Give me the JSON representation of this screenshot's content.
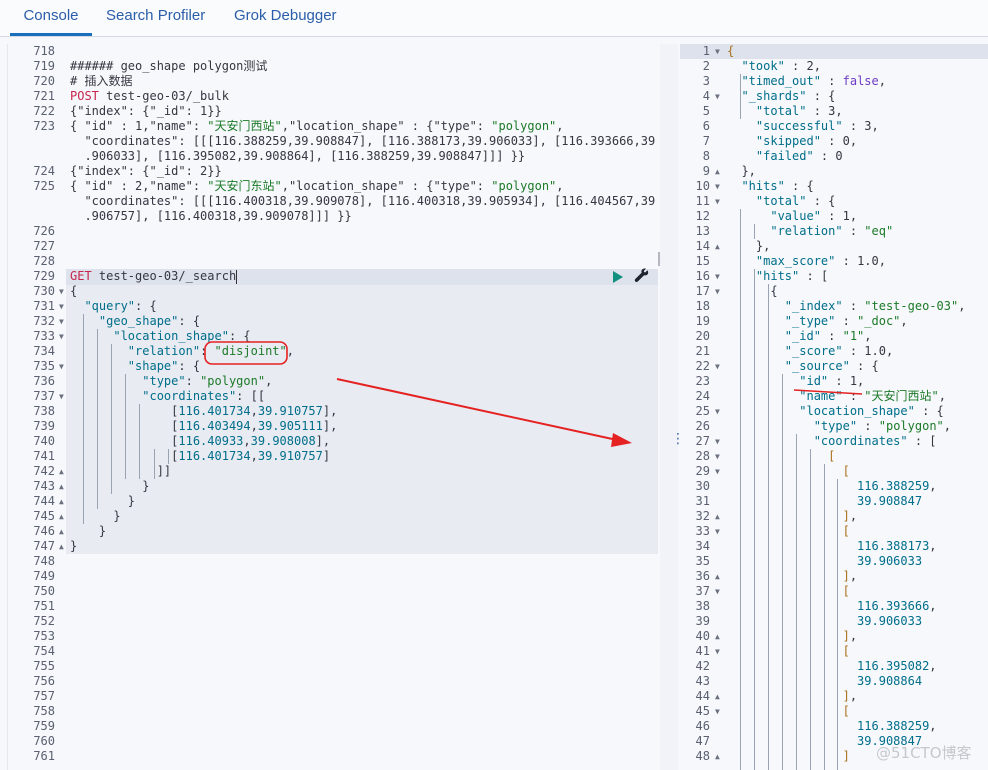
{
  "tabs": [
    {
      "label": "Console",
      "active": true
    },
    {
      "label": "Search Profiler",
      "active": false
    },
    {
      "label": "Grok Debugger",
      "active": false
    }
  ],
  "colors": {
    "accent": "#1a6fbd",
    "method": "#c7254e",
    "string": "#1c7a28",
    "key": "#006e8a",
    "keyword": "#6d3bc4",
    "annotation_red": "#e52222",
    "run_button": "#11907f"
  },
  "request_editor": {
    "lines": [
      {
        "n": "718",
        "fold": "",
        "html": ""
      },
      {
        "n": "719",
        "fold": "",
        "html": "<span class='code'>###### geo_shape polygon测试</span>"
      },
      {
        "n": "720",
        "fold": "",
        "html": "<span class='code'># 插入数据</span>"
      },
      {
        "n": "721",
        "fold": "",
        "html": "<span class='k'>POST</span><span class='code'> test-geo-03/_bulk</span>"
      },
      {
        "n": "722",
        "fold": "",
        "html": "<span class='code'>{\"index\": {\"_id\": 1}}</span>"
      },
      {
        "n": "723",
        "fold": "",
        "html": "<span class='code'>{ \"id\" : 1,\"name\": </span><span class='str'>\"天安门西站\"</span><span class='code'>,\"location_shape\" : {\"type\": </span><span class='str'>\"polygon\"</span><span class='code'>,</span>"
      },
      {
        "n": "",
        "fold": "",
        "html": "<span class='code'>  \"coordinates\": [[[116.388259,39.908847], [116.388173,39.906033], [116.393666,39</span>"
      },
      {
        "n": "",
        "fold": "",
        "html": "<span class='code'>  .906033], [116.395082,39.908864], [116.388259,39.908847]]] }}</span>"
      },
      {
        "n": "724",
        "fold": "",
        "html": "<span class='code'>{\"index\": {\"_id\": 2}}</span>"
      },
      {
        "n": "725",
        "fold": "",
        "html": "<span class='code'>{ \"id\" : 2,\"name\": </span><span class='str'>\"天安门东站\"</span><span class='code'>,\"location_shape\" : {\"type\": </span><span class='str'>\"polygon\"</span><span class='code'>,</span>"
      },
      {
        "n": "",
        "fold": "",
        "html": "<span class='code'>  \"coordinates\": [[[116.400318,39.909078], [116.400318,39.905934], [116.404567,39</span>"
      },
      {
        "n": "",
        "fold": "",
        "html": "<span class='code'>  .906757], [116.400318,39.909078]]] }}</span>"
      },
      {
        "n": "726",
        "fold": "",
        "html": ""
      },
      {
        "n": "727",
        "fold": "",
        "html": ""
      },
      {
        "n": "728",
        "fold": "",
        "html": ""
      },
      {
        "n": "729",
        "fold": "",
        "html": "<span class='k'>GET</span><span class='code'> test-geo-03/_search</span><span class='cursor'></span>"
      },
      {
        "n": "730",
        "fold": "▼",
        "html": "<span class='code'>{</span>"
      },
      {
        "n": "731",
        "fold": "▼",
        "html": "<span class='code'>  </span><span class='s'>\"query\"</span><span class='code'>: {</span>"
      },
      {
        "n": "732",
        "fold": "▼",
        "html": "<span class='code'>    </span><span class='s'>\"geo_shape\"</span><span class='code'>: {</span>"
      },
      {
        "n": "733",
        "fold": "▼",
        "html": "<span class='code'>      </span><span class='s'>\"location_shape\"</span><span class='code'>: {</span>"
      },
      {
        "n": "734",
        "fold": "",
        "html": "<span class='code'>        </span><span class='s'>\"relation\"</span><span class='code'>: </span><span class='str'>\"disjoint\"</span><span class='code'>,</span>"
      },
      {
        "n": "735",
        "fold": "▼",
        "html": "<span class='code'>        </span><span class='s'>\"shape\"</span><span class='code'>: {</span>"
      },
      {
        "n": "736",
        "fold": "",
        "html": "<span class='code'>          </span><span class='s'>\"type\"</span><span class='code'>: </span><span class='str'>\"polygon\"</span><span class='code'>,</span>"
      },
      {
        "n": "737",
        "fold": "▼",
        "html": "<span class='code'>          </span><span class='s'>\"coordinates\"</span><span class='code'>: [[</span>"
      },
      {
        "n": "738",
        "fold": "",
        "html": "<span class='code'>              [</span><span class='num'>116.401734</span><span class='code'>,</span><span class='num'>39.910757</span><span class='code'>],</span>"
      },
      {
        "n": "739",
        "fold": "",
        "html": "<span class='code'>              [</span><span class='num'>116.403494</span><span class='code'>,</span><span class='num'>39.905111</span><span class='code'>],</span>"
      },
      {
        "n": "740",
        "fold": "",
        "html": "<span class='code'>              [</span><span class='num'>116.40933</span><span class='code'>,</span><span class='num'>39.908008</span><span class='code'>],</span>"
      },
      {
        "n": "741",
        "fold": "",
        "html": "<span class='code'>              [</span><span class='num'>116.401734</span><span class='code'>,</span><span class='num'>39.910757</span><span class='code'>]</span>"
      },
      {
        "n": "742",
        "fold": "▲",
        "html": "<span class='code'>            ]]</span>"
      },
      {
        "n": "743",
        "fold": "▲",
        "html": "<span class='code'>          }</span>"
      },
      {
        "n": "744",
        "fold": "▲",
        "html": "<span class='code'>        }</span>"
      },
      {
        "n": "745",
        "fold": "▲",
        "html": "<span class='code'>      }</span>"
      },
      {
        "n": "746",
        "fold": "▲",
        "html": "<span class='code'>    }</span>"
      },
      {
        "n": "747",
        "fold": "▲",
        "html": "<span class='code'>}</span>"
      },
      {
        "n": "748",
        "fold": "",
        "html": ""
      },
      {
        "n": "749",
        "fold": "",
        "html": ""
      },
      {
        "n": "750",
        "fold": "",
        "html": ""
      },
      {
        "n": "751",
        "fold": "",
        "html": ""
      },
      {
        "n": "752",
        "fold": "",
        "html": ""
      },
      {
        "n": "753",
        "fold": "",
        "html": ""
      },
      {
        "n": "754",
        "fold": "",
        "html": ""
      },
      {
        "n": "755",
        "fold": "",
        "html": ""
      },
      {
        "n": "756",
        "fold": "",
        "html": ""
      },
      {
        "n": "757",
        "fold": "",
        "html": ""
      },
      {
        "n": "758",
        "fold": "",
        "html": ""
      },
      {
        "n": "759",
        "fold": "",
        "html": ""
      },
      {
        "n": "760",
        "fold": "",
        "html": ""
      },
      {
        "n": "761",
        "fold": "",
        "html": ""
      }
    ]
  },
  "response_editor": {
    "lines": [
      {
        "n": "1",
        "fold": "▼",
        "html": "<span class='br'>{</span>"
      },
      {
        "n": "2",
        "fold": "",
        "html": "<span class='code'>  </span><span class='s'>\"took\"</span><span class='code'> : 2,</span>"
      },
      {
        "n": "3",
        "fold": "",
        "html": "<span class='code'>  </span><span class='s'>\"timed_out\"</span><span class='code'> : </span><span class='kw'>false</span><span class='code'>,</span>"
      },
      {
        "n": "4",
        "fold": "▼",
        "html": "<span class='code'>  </span><span class='s'>\"_shards\"</span><span class='code'> : {</span>"
      },
      {
        "n": "5",
        "fold": "",
        "html": "<span class='code'>    </span><span class='s'>\"total\"</span><span class='code'> : 3,</span>"
      },
      {
        "n": "6",
        "fold": "",
        "html": "<span class='code'>    </span><span class='s'>\"successful\"</span><span class='code'> : 3,</span>"
      },
      {
        "n": "7",
        "fold": "",
        "html": "<span class='code'>    </span><span class='s'>\"skipped\"</span><span class='code'> : 0,</span>"
      },
      {
        "n": "8",
        "fold": "",
        "html": "<span class='code'>    </span><span class='s'>\"failed\"</span><span class='code'> : 0</span>"
      },
      {
        "n": "9",
        "fold": "▲",
        "html": "<span class='code'>  },</span>"
      },
      {
        "n": "10",
        "fold": "▼",
        "html": "<span class='code'>  </span><span class='s'>\"hits\"</span><span class='code'> : {</span>"
      },
      {
        "n": "11",
        "fold": "▼",
        "html": "<span class='code'>    </span><span class='s'>\"total\"</span><span class='code'> : {</span>"
      },
      {
        "n": "12",
        "fold": "",
        "html": "<span class='code'>      </span><span class='s'>\"value\"</span><span class='code'> : 1,</span>"
      },
      {
        "n": "13",
        "fold": "",
        "html": "<span class='code'>      </span><span class='s'>\"relation\"</span><span class='code'> : </span><span class='str'>\"eq\"</span>"
      },
      {
        "n": "14",
        "fold": "▲",
        "html": "<span class='code'>    },</span>"
      },
      {
        "n": "15",
        "fold": "",
        "html": "<span class='code'>    </span><span class='s'>\"max_score\"</span><span class='code'> : 1.0,</span>"
      },
      {
        "n": "16",
        "fold": "▼",
        "html": "<span class='code'>    </span><span class='s'>\"hits\"</span><span class='code'> : [</span>"
      },
      {
        "n": "17",
        "fold": "▼",
        "html": "<span class='code'>      {</span>"
      },
      {
        "n": "18",
        "fold": "",
        "html": "<span class='code'>        </span><span class='s'>\"_index\"</span><span class='code'> : </span><span class='str'>\"test-geo-03\"</span><span class='code'>,</span>"
      },
      {
        "n": "19",
        "fold": "",
        "html": "<span class='code'>        </span><span class='s'>\"_type\"</span><span class='code'> : </span><span class='str'>\"_doc\"</span><span class='code'>,</span>"
      },
      {
        "n": "20",
        "fold": "",
        "html": "<span class='code'>        </span><span class='s'>\"_id\"</span><span class='code'> : </span><span class='str'>\"1\"</span><span class='code'>,</span>"
      },
      {
        "n": "21",
        "fold": "",
        "html": "<span class='code'>        </span><span class='s'>\"_score\"</span><span class='code'> : 1.0,</span>"
      },
      {
        "n": "22",
        "fold": "▼",
        "html": "<span class='code'>        </span><span class='s'>\"_source\"</span><span class='code'> : {</span>"
      },
      {
        "n": "23",
        "fold": "",
        "html": "<span class='code'>          </span><span class='s'>\"id\"</span><span class='code'> : 1,</span>"
      },
      {
        "n": "24",
        "fold": "",
        "html": "<span class='code'>          </span><span class='s'>\"name\"</span><span class='code'> : </span><span class='str'>\"天安门西站\"</span><span class='code'>,</span>"
      },
      {
        "n": "25",
        "fold": "▼",
        "html": "<span class='code'>          </span><span class='s'>\"location_shape\"</span><span class='code'> : {</span>"
      },
      {
        "n": "26",
        "fold": "",
        "html": "<span class='code'>            </span><span class='s'>\"type\"</span><span class='code'> : </span><span class='str'>\"polygon\"</span><span class='code'>,</span>"
      },
      {
        "n": "27",
        "fold": "▼",
        "html": "<span class='code'>            </span><span class='s'>\"coordinates\"</span><span class='code'> : [</span>"
      },
      {
        "n": "28",
        "fold": "▼",
        "html": "<span class='code'>              </span><span class='br'>[</span>"
      },
      {
        "n": "29",
        "fold": "▼",
        "html": "<span class='code'>                </span><span class='br'>[</span>"
      },
      {
        "n": "30",
        "fold": "",
        "html": "<span class='code'>                  </span><span class='num'>116.388259</span><span class='code'>,</span>"
      },
      {
        "n": "31",
        "fold": "",
        "html": "<span class='code'>                  </span><span class='num'>39.908847</span>"
      },
      {
        "n": "32",
        "fold": "▲",
        "html": "<span class='code'>                </span><span class='br'>]</span><span class='code'>,</span>"
      },
      {
        "n": "33",
        "fold": "▼",
        "html": "<span class='code'>                </span><span class='br'>[</span>"
      },
      {
        "n": "34",
        "fold": "",
        "html": "<span class='code'>                  </span><span class='num'>116.388173</span><span class='code'>,</span>"
      },
      {
        "n": "35",
        "fold": "",
        "html": "<span class='code'>                  </span><span class='num'>39.906033</span>"
      },
      {
        "n": "36",
        "fold": "▲",
        "html": "<span class='code'>                </span><span class='br'>]</span><span class='code'>,</span>"
      },
      {
        "n": "37",
        "fold": "▼",
        "html": "<span class='code'>                </span><span class='br'>[</span>"
      },
      {
        "n": "38",
        "fold": "",
        "html": "<span class='code'>                  </span><span class='num'>116.393666</span><span class='code'>,</span>"
      },
      {
        "n": "39",
        "fold": "",
        "html": "<span class='code'>                  </span><span class='num'>39.906033</span>"
      },
      {
        "n": "40",
        "fold": "▲",
        "html": "<span class='code'>                </span><span class='br'>]</span><span class='code'>,</span>"
      },
      {
        "n": "41",
        "fold": "▼",
        "html": "<span class='code'>                </span><span class='br'>[</span>"
      },
      {
        "n": "42",
        "fold": "",
        "html": "<span class='code'>                  </span><span class='num'>116.395082</span><span class='code'>,</span>"
      },
      {
        "n": "43",
        "fold": "",
        "html": "<span class='code'>                  </span><span class='num'>39.908864</span>"
      },
      {
        "n": "44",
        "fold": "▲",
        "html": "<span class='code'>                </span><span class='br'>]</span><span class='code'>,</span>"
      },
      {
        "n": "45",
        "fold": "▼",
        "html": "<span class='code'>                </span><span class='br'>[</span>"
      },
      {
        "n": "46",
        "fold": "",
        "html": "<span class='code'>                  </span><span class='num'>116.388259</span><span class='code'>,</span>"
      },
      {
        "n": "47",
        "fold": "",
        "html": "<span class='code'>                  </span><span class='num'>39.908847</span>"
      },
      {
        "n": "48",
        "fold": "▲",
        "html": "<span class='code'>                </span><span class='br'>]</span>"
      }
    ]
  },
  "actions": {
    "run_label": "Click to send request",
    "settings_label": "Request options"
  },
  "watermark": "@51CTO博客"
}
